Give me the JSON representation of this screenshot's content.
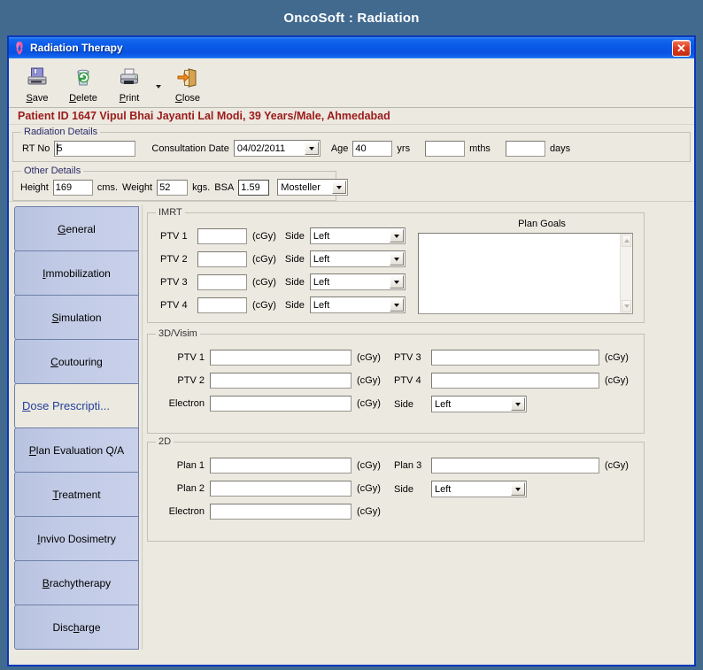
{
  "app": {
    "title": "OncoSoft : Radiation"
  },
  "window": {
    "title": "Radiation Therapy",
    "title_icon": "pink-ribbon-icon",
    "close_label": "✕"
  },
  "toolbar": {
    "buttons": [
      {
        "label": "Save",
        "accel": "S",
        "icon": "save-disk-icon"
      },
      {
        "label": "Delete",
        "accel": "D",
        "icon": "recycle-bin-icon"
      },
      {
        "label": "Print",
        "accel": "P",
        "icon": "printer-icon"
      },
      {
        "label": "Close",
        "accel": "C",
        "icon": "exit-door-icon"
      }
    ],
    "print_dropdown_icon": "chevron-down-icon"
  },
  "patient": {
    "banner": "Patient ID 1647 Vipul Bhai Jayanti Lal  Modi, 39 Years/Male, Ahmedabad"
  },
  "radiation_details": {
    "legend": "Radiation Details",
    "rt_no_label": "RT No",
    "rt_no_value": "5",
    "consultation_date_label": "Consultation Date",
    "consultation_date_value": "04/02/2011",
    "age_label": "Age",
    "age_value": "40",
    "yrs_label": "yrs",
    "mths_value": "",
    "mths_label": "mths",
    "days_value": "",
    "days_label": "days"
  },
  "other_details": {
    "legend": "Other Details",
    "height_label": "Height",
    "height_value": "169",
    "cms_label": "cms.",
    "weight_label": "Weight",
    "weight_value": "52",
    "kgs_label": "kgs.",
    "bsa_label": "BSA",
    "bsa_value": "1.59",
    "formula_value": "Mosteller"
  },
  "tabs": [
    {
      "label": "General",
      "accel": "G",
      "selected": false
    },
    {
      "label": "Immobilization",
      "accel": "I",
      "selected": false
    },
    {
      "label": "Simulation",
      "accel": "S",
      "selected": false
    },
    {
      "label": "Coutouring",
      "accel": "C",
      "selected": false
    },
    {
      "label": "Dose Prescripti...",
      "accel": "D",
      "selected": true
    },
    {
      "label": "Plan Evaluation Q/A",
      "accel": "P",
      "selected": false
    },
    {
      "label": "Treatment",
      "accel": "T",
      "selected": false
    },
    {
      "label": "Invivo Dosimetry",
      "accel": "I",
      "selected": false
    },
    {
      "label": "Brachytherapy",
      "accel": "B",
      "selected": false
    },
    {
      "label": "Discharge",
      "accel": "h",
      "selected": false
    }
  ],
  "imrt": {
    "legend": "IMRT",
    "unit": "(cGy)",
    "side_label": "Side",
    "plan_goals_label": "Plan Goals",
    "plan_goals_value": "",
    "rows": [
      {
        "label": "PTV 1",
        "value": "",
        "side": "Left"
      },
      {
        "label": "PTV 2",
        "value": "",
        "side": "Left"
      },
      {
        "label": "PTV 3",
        "value": "",
        "side": "Left"
      },
      {
        "label": "PTV 4",
        "value": "",
        "side": "Left"
      }
    ]
  },
  "threed": {
    "legend": "3D/Visim",
    "unit": "(cGy)",
    "side_label": "Side",
    "side_value": "Left",
    "left_rows": [
      {
        "label": "PTV 1",
        "value": ""
      },
      {
        "label": "PTV 2",
        "value": ""
      },
      {
        "label": "Electron",
        "value": ""
      }
    ],
    "right_rows": [
      {
        "label": "PTV 3",
        "value": ""
      },
      {
        "label": "PTV 4",
        "value": ""
      }
    ]
  },
  "twod": {
    "legend": "2D",
    "unit": "(cGy)",
    "side_label": "Side",
    "side_value": "Left",
    "left_rows": [
      {
        "label": "Plan 1",
        "value": ""
      },
      {
        "label": "Plan 2",
        "value": ""
      },
      {
        "label": "Electron",
        "value": ""
      }
    ],
    "right_rows": [
      {
        "label": "Plan 3",
        "value": ""
      }
    ]
  },
  "colors": {
    "desktop": "#426a8f",
    "window_border": "#0a37bb",
    "titlebar": "#0a52e2",
    "face": "#ece9e0",
    "banner_text": "#9b1b1b",
    "tab_face": "#c2cbe6",
    "tab_border": "#6e7fa8",
    "selected_tab_text": "#22409c"
  }
}
